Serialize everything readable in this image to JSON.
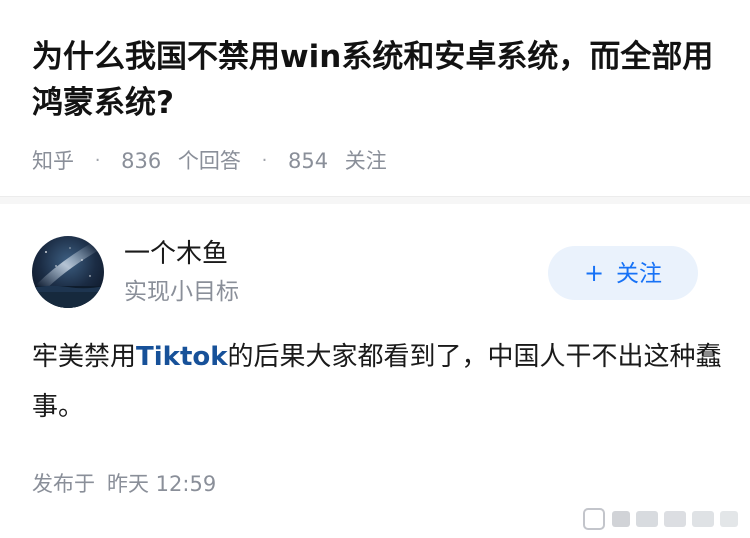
{
  "question": {
    "title": "为什么我国不禁用win系统和安卓系统，而全部用鸿蒙系统?",
    "source": "知乎",
    "answers_count": "836",
    "answers_label": "个回答",
    "followers_count": "854",
    "followers_label": "关注"
  },
  "answer": {
    "author": {
      "name": "一个木鱼",
      "tagline": "实现小目标",
      "avatar_icon": "night-sky-avatar"
    },
    "follow_button": {
      "icon": "plus-icon",
      "plus": "+",
      "label": "关注"
    },
    "content": {
      "before": "牢美禁用",
      "link": "Tiktok",
      "after": "的后果大家都看到了，中国人干不出这种蠢事。"
    },
    "publish_label": "发布于",
    "publish_time": "昨天 12:59"
  },
  "colors": {
    "accent": "#1772f6",
    "link": "#175199",
    "meta": "#8a8f99",
    "follow_bg": "#eaf2fc"
  }
}
